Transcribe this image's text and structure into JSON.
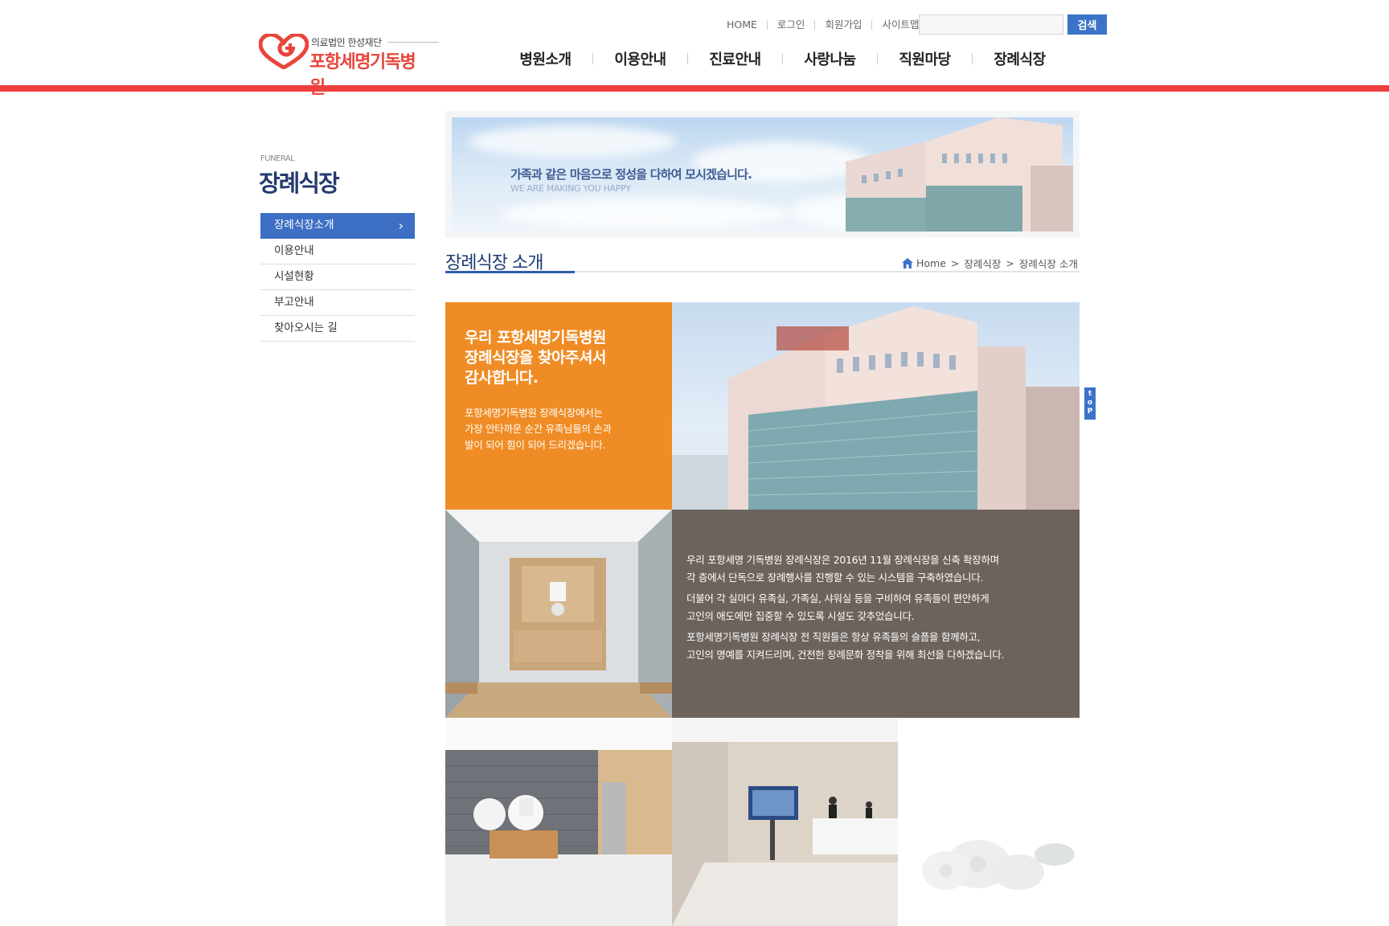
{
  "header": {
    "logo": {
      "subtitle": "의료법인 한성재단",
      "name": "포항세명기독병원"
    },
    "util_nav": [
      "HOME",
      "로그인",
      "회원가입",
      "사이트맵"
    ],
    "search": {
      "value": "",
      "placeholder": "",
      "button_label": "검색"
    },
    "main_nav": [
      "병원소개",
      "이용안내",
      "진료안내",
      "사랑나눔",
      "직원마당",
      "장례식장"
    ],
    "colors": {
      "accent_red": "#ee3f3f",
      "accent_blue": "#3b73c9"
    }
  },
  "sidebar": {
    "section_en": "FUNERAL",
    "section_title": "장례식장",
    "items": [
      {
        "label": "장례식장소개",
        "active": true
      },
      {
        "label": "이용안내",
        "active": false
      },
      {
        "label": "시설현황",
        "active": false
      },
      {
        "label": "부고안내",
        "active": false
      },
      {
        "label": "찾아오시는 길",
        "active": false
      }
    ]
  },
  "banner": {
    "headline": "가족과 같은 마음으로 정성을 다하여 모시겠습니다.",
    "subline": "WE ARE MAKING YOU HAPPY"
  },
  "page": {
    "title": "장례식장 소개",
    "breadcrumb": [
      "Home",
      "장례식장",
      "장례식장 소개"
    ]
  },
  "content": {
    "orange_heading": [
      "우리 포항세명기독병원",
      "장례식장을 찾아주셔서",
      "감사합니다."
    ],
    "orange_body": [
      "포항세명기독병원 장례식장에서는",
      "가장 안타까운 순간 유족님들의 손과",
      "발이 되어 힘이 되어 드리겠습니다."
    ],
    "brown_body": [
      [
        "우리 포항세명 기독병원 장례식장은 2016년 11월 장례식장을 신축 확장하며",
        "각 층에서 단독으로 장례행사를 진행할 수 있는 시스템을 구축하였습니다."
      ],
      [
        "더불어 각 실마다 유족실, 가족실, 샤워실 등을 구비하여 유족들이 편안하게",
        "고인의 애도에만 집중할 수 있도록 시설도 갖추었습니다."
      ],
      [
        "포항세명기독병원 장례식장 전 직원들은 항상 유족들의 슬픔을 함께하고,",
        "고인의 명예를 지켜드리며, 건전한 장례문화 정착을 위해 최선을 다하겠습니다."
      ]
    ],
    "colors": {
      "orange": "#f08c25",
      "brown": "#6c635c"
    }
  },
  "top_button": {
    "label_lines": [
      "t",
      "o",
      "P"
    ]
  }
}
